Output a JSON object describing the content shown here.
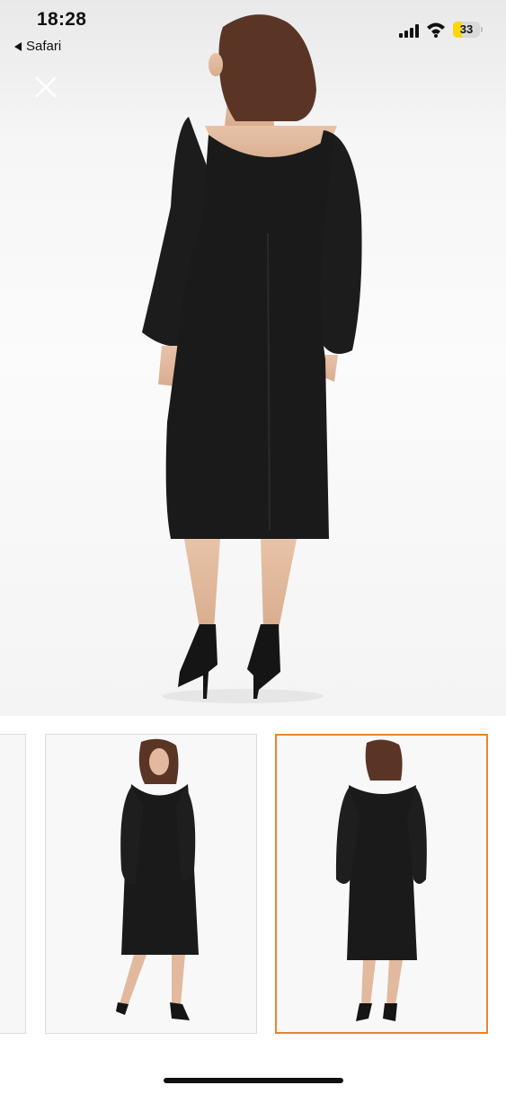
{
  "status_bar": {
    "time": "18:28",
    "back_label": "Safari",
    "battery_level": "33",
    "battery_color": "#ffd60a"
  },
  "viewer": {
    "close_icon": "close-icon",
    "main_image": "black-dress-model-back-view",
    "thumbnails": [
      {
        "image": "partial-product-thumbnail",
        "selected": false
      },
      {
        "image": "black-dress-model-front-view",
        "selected": false
      },
      {
        "image": "black-dress-model-back-view",
        "selected": true
      }
    ],
    "selected_border_color": "#e8852c"
  }
}
